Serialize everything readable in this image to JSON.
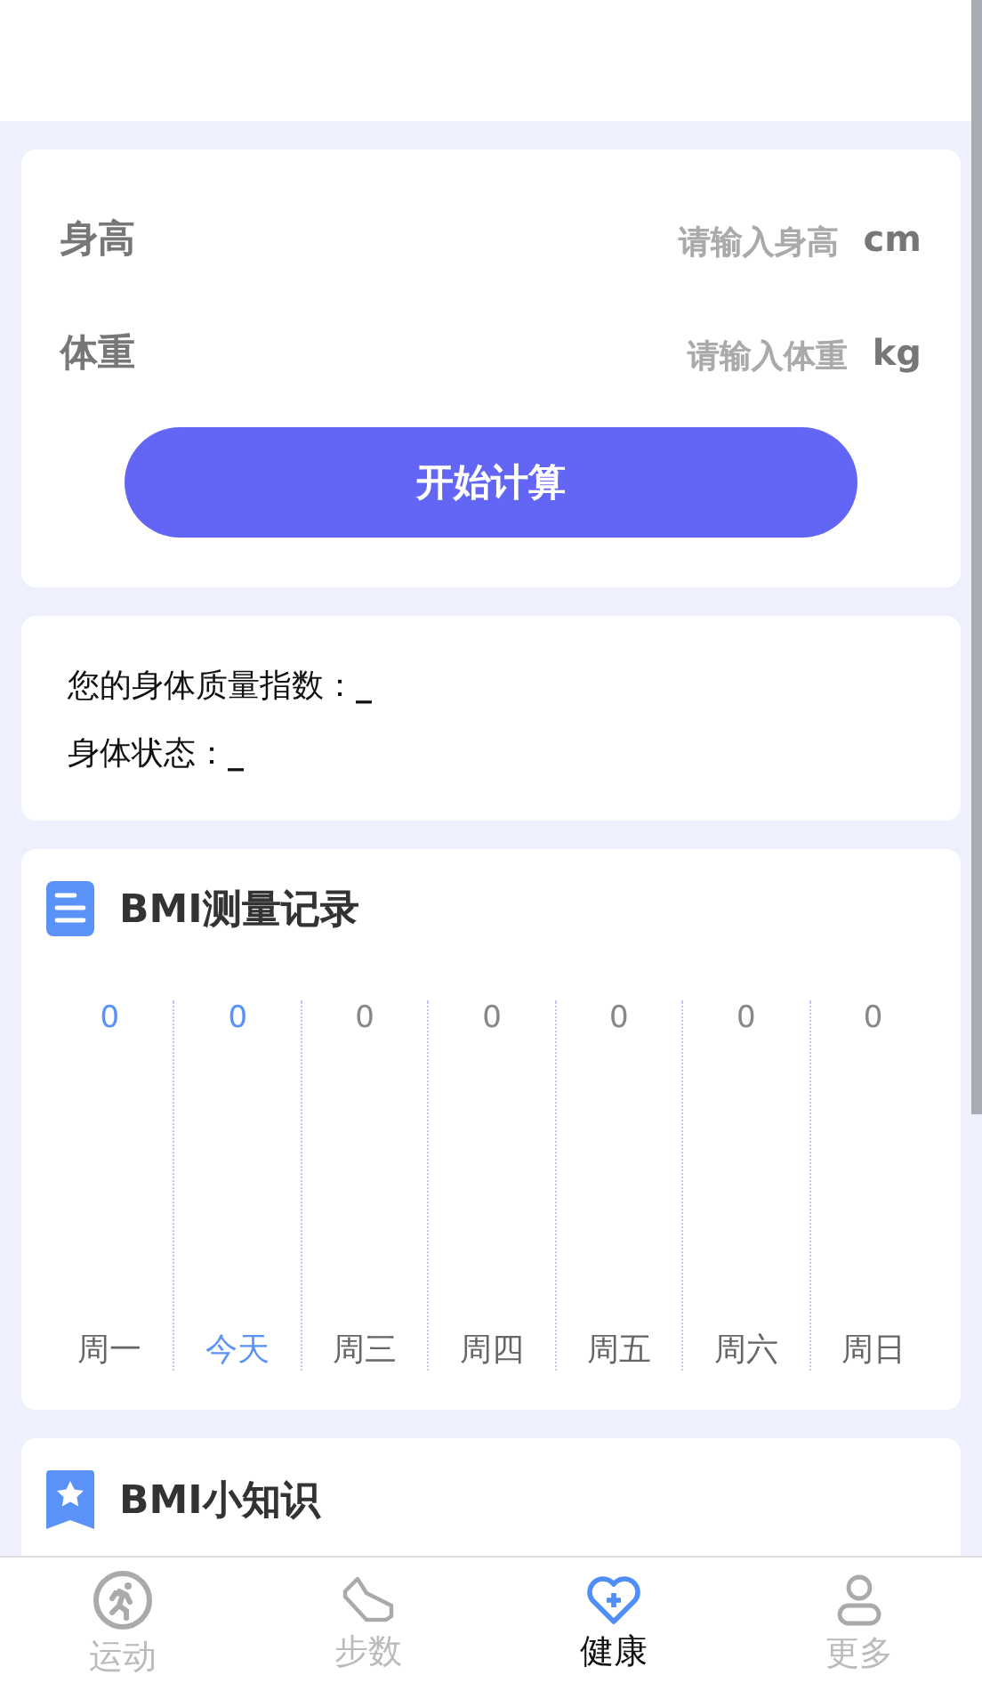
{
  "form": {
    "fields": [
      {
        "label": "身高",
        "placeholder": "请输入身高",
        "unit": "cm"
      },
      {
        "label": "体重",
        "placeholder": "请输入体重",
        "unit": "kg"
      }
    ],
    "button": "开始计算"
  },
  "result": {
    "lines": [
      {
        "label": "您的身体质量指数：",
        "value": "_"
      },
      {
        "label": "身体状态：",
        "value": "_"
      }
    ]
  },
  "record": {
    "title": "BMI测量记录",
    "days": [
      {
        "value": "0",
        "label": "周一",
        "highlighted": true,
        "selected": false
      },
      {
        "value": "0",
        "label": "今天",
        "highlighted": true,
        "selected": true
      },
      {
        "value": "0",
        "label": "周三",
        "highlighted": false,
        "selected": false
      },
      {
        "value": "0",
        "label": "周四",
        "highlighted": false,
        "selected": false
      },
      {
        "value": "0",
        "label": "周五",
        "highlighted": false,
        "selected": false
      },
      {
        "value": "0",
        "label": "周六",
        "highlighted": false,
        "selected": false
      },
      {
        "value": "0",
        "label": "周日",
        "highlighted": false,
        "selected": false
      }
    ]
  },
  "tips": {
    "title": "BMI小知识"
  },
  "tab_bar": [
    {
      "kind": "run",
      "label": "运动",
      "selected": false
    },
    {
      "kind": "shoe",
      "label": "步数",
      "selected": false
    },
    {
      "kind": "heart",
      "label": "健康",
      "selected": true
    },
    {
      "kind": "person",
      "label": "更多",
      "selected": false
    }
  ]
}
